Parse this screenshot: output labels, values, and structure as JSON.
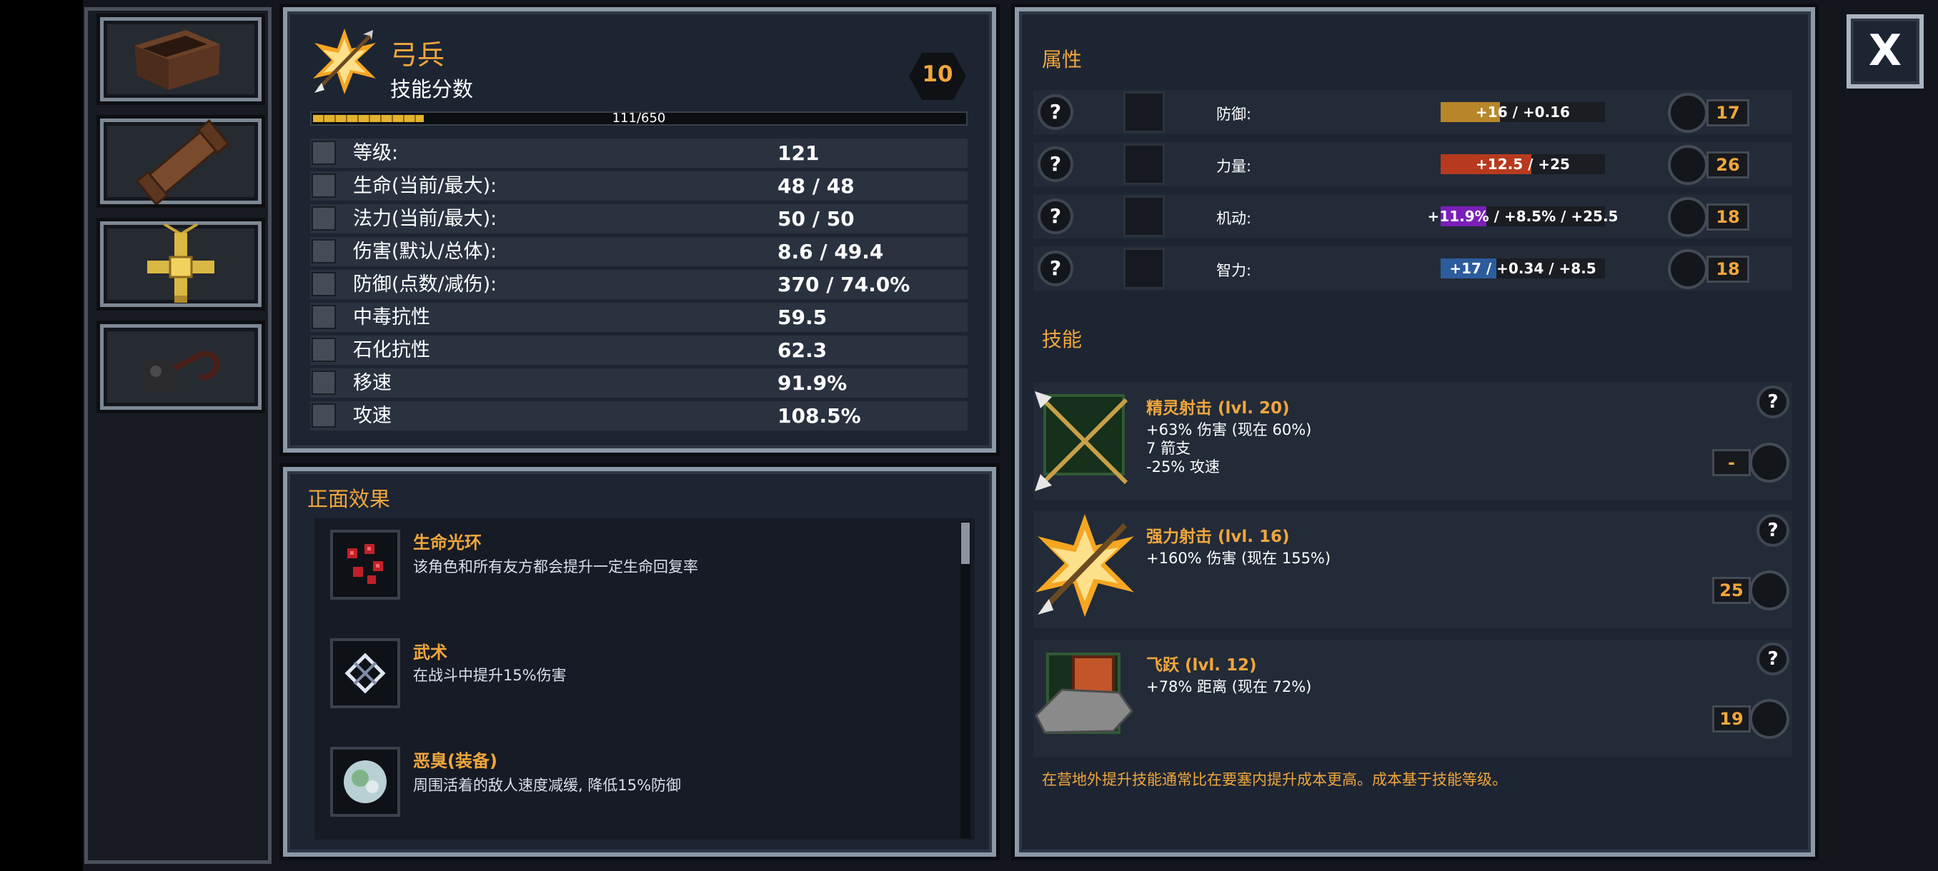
{
  "character": {
    "name": "弓兵",
    "subtitle": "技能分数",
    "skill_points": "10",
    "xp_text": "111/650",
    "xp_fraction": 0.17
  },
  "stats": [
    {
      "label": "等级:",
      "value": "121",
      "icon": "level-icon"
    },
    {
      "label": "生命(当前/最大):",
      "value": "48 / 48",
      "icon": "health-icon"
    },
    {
      "label": "法力(当前/最大):",
      "value": "50 / 50",
      "icon": "mana-icon"
    },
    {
      "label": "伤害(默认/总体):",
      "value": "8.6 / 49.4",
      "icon": "damage-icon"
    },
    {
      "label": "防御(点数/减伤):",
      "value": "370 / 74.0%",
      "icon": "defense-icon"
    },
    {
      "label": "中毒抗性",
      "value": "59.5",
      "icon": "poison-resist-icon"
    },
    {
      "label": "石化抗性",
      "value": "62.3",
      "icon": "petrify-resist-icon"
    },
    {
      "label": "移速",
      "value": "91.9%",
      "icon": "move-speed-icon"
    },
    {
      "label": "攻速",
      "value": "108.5%",
      "icon": "attack-speed-icon"
    }
  ],
  "effects": {
    "heading": "正面效果",
    "items": [
      {
        "title": "生命光环",
        "desc": "该角色和所有友方都会提升一定生命回复率",
        "icon": "life-aura-icon"
      },
      {
        "title": "武术",
        "desc": "在战斗中提升15%伤害",
        "icon": "martial-arts-icon"
      },
      {
        "title": "恶臭(装备)",
        "desc": "周围活着的敌人速度减缓, 降低15%防御",
        "icon": "stench-icon"
      }
    ]
  },
  "attributes": {
    "heading": "属性",
    "help": "?",
    "items": [
      {
        "name": "防御:",
        "bar_text": "+16 / +0.16",
        "cost": "17",
        "bar_color": "#b8862a",
        "fill": 0.36,
        "icon": "defense-attr-icon",
        "highlight": false
      },
      {
        "name": "力量:",
        "bar_text": "+12.5 / +25",
        "cost": "26",
        "bar_color": "#b73a1e",
        "fill": 0.55,
        "icon": "strength-icon",
        "highlight": false
      },
      {
        "name": "机动:",
        "bar_text": "+11.9% / +8.5% / +25.5",
        "cost": "18",
        "bar_color": "#7a1fb8",
        "fill": 0.28,
        "icon": "agility-icon",
        "highlight": true
      },
      {
        "name": "智力:",
        "bar_text": "+17 / +0.34 / +8.5",
        "cost": "18",
        "bar_color": "#2c5c9c",
        "fill": 0.34,
        "icon": "intelligence-icon",
        "highlight": false
      }
    ]
  },
  "skills": {
    "heading": "技能",
    "help": "?",
    "items": [
      {
        "title": "精灵射击 (lvl. 20)",
        "lines": [
          "+63% 伤害 (现在 60%)",
          "7 箭支",
          "-25% 攻速"
        ],
        "cost": "-",
        "icon": "elf-shot-icon"
      },
      {
        "title": "强力射击 (lvl. 16)",
        "lines": [
          "+160% 伤害 (现在 155%)"
        ],
        "cost": "25",
        "icon": "power-shot-icon"
      },
      {
        "title": "飞跃 (lvl. 12)",
        "lines": [
          "+78% 距离 (现在 72%)"
        ],
        "cost": "19",
        "icon": "leap-icon"
      }
    ],
    "footnote": "在营地外提升技能通常比在要塞内提升成本更高。成本基于技能等级。"
  },
  "close_label": "X"
}
